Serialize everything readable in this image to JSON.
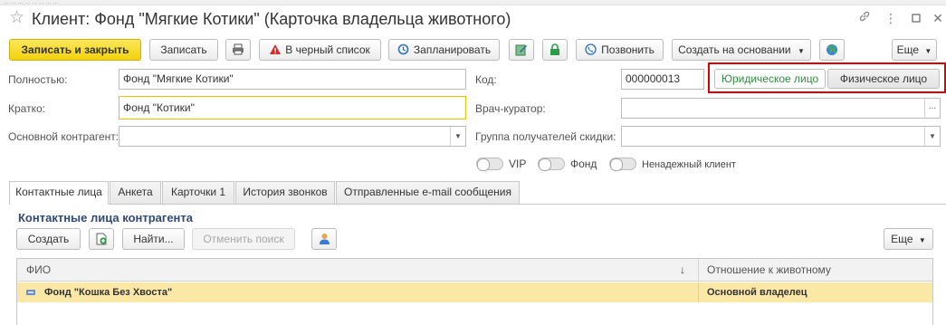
{
  "top_strip": "... ... ... ... ... ... ... ...",
  "window": {
    "title": "Клиент: Фонд \"Мягкие Котики\" (Карточка владельца животного)"
  },
  "toolbar": {
    "save_close": "Записать и закрыть",
    "save": "Записать",
    "blacklist": "В черный список",
    "schedule": "Запланировать",
    "call": "Позвонить",
    "create_based": "Создать на основании",
    "more": "Еще"
  },
  "form": {
    "full_name_label": "Полностью:",
    "full_name_value": "Фонд \"Мягкие Котики\"",
    "short_label": "Кратко:",
    "short_value": "Фонд \"Котики\"",
    "main_contractor_label": "Основной контрагент:",
    "main_contractor_value": "",
    "code_label": "Код:",
    "code_value": "000000013",
    "vet_label": "Врач-куратор:",
    "vet_value": "",
    "discount_group_label": "Группа получателей скидки:",
    "discount_group_value": ""
  },
  "entity_type": {
    "legal": "Юридическое лицо",
    "individual": "Физическое лицо",
    "selected": "legal"
  },
  "flags": [
    {
      "label": "VIP",
      "on": false
    },
    {
      "label": "Фонд",
      "on": false
    },
    {
      "label": "Ненадежный клиент",
      "on": false
    }
  ],
  "tabs": [
    {
      "label": "Контактные лица",
      "active": true
    },
    {
      "label": "Анкета",
      "active": false
    },
    {
      "label": "Карточки 1",
      "active": false
    },
    {
      "label": "История звонков",
      "active": false
    },
    {
      "label": "Отправленные e-mail сообщения",
      "active": false
    }
  ],
  "contacts": {
    "section_title": "Контактные лица контрагента",
    "create": "Создать",
    "find": "Найти...",
    "cancel_search": "Отменить поиск",
    "more": "Еще",
    "columns": {
      "name": "ФИО",
      "sort_mark": "↓",
      "relation": "Отношение к животному"
    },
    "rows": [
      {
        "name": "Фонд \"Кошка Без Хвоста\"",
        "relation": "Основной владелец"
      }
    ]
  },
  "colors": {
    "primary_button": "#f3d20d",
    "highlight_row": "#fbe7a6",
    "section_title": "#2f4a7a",
    "selected_toggle_text": "#2d8c3c",
    "annotation_frame": "#e10000"
  }
}
